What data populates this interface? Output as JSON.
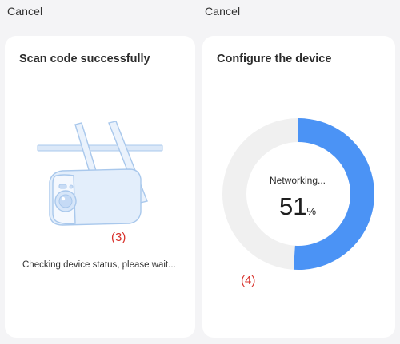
{
  "left_panel": {
    "cancel_label": "Cancel",
    "title": "Scan code successfully",
    "step_marker": "(3)",
    "status_text": "Checking device status, please wait..."
  },
  "right_panel": {
    "cancel_label": "Cancel",
    "title": "Configure the device",
    "progress_label": "Networking...",
    "progress_percent": 51,
    "progress_percent_text": "51",
    "percent_sign": "%",
    "step_marker": "(4)"
  },
  "colors": {
    "progress_fill": "#4b93f5",
    "progress_track": "#f0f0f0",
    "step_marker": "#d8312b",
    "camera_outline": "#a9c8ec"
  },
  "icons": [
    "camera-illustration-icon"
  ]
}
